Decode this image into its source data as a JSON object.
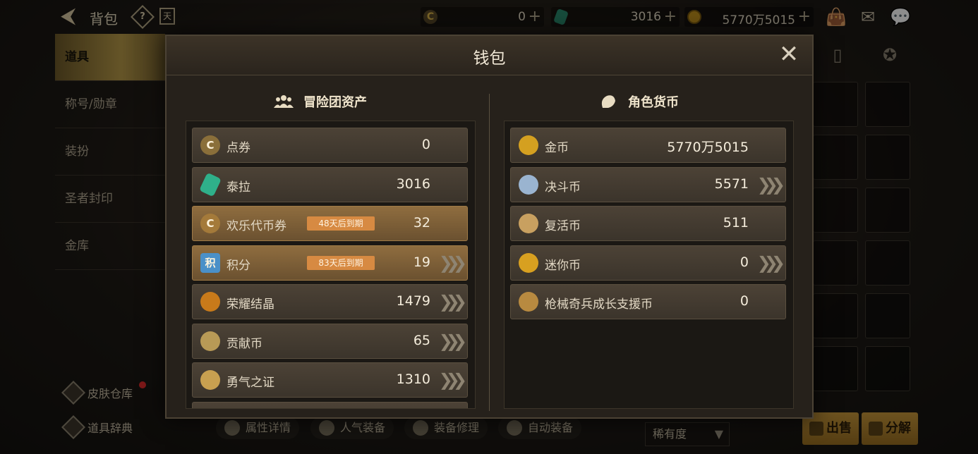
{
  "header": {
    "title": "背包",
    "help_label": "?",
    "calendar_label": "天",
    "currencies": [
      {
        "icon": "cera-point-icon",
        "value": "0",
        "plus": "+"
      },
      {
        "icon": "terra-gem-icon",
        "value": "3016",
        "plus": "+"
      },
      {
        "icon": "gold-coin-icon",
        "value": "5770万5015",
        "plus": "+"
      }
    ]
  },
  "sidebar": {
    "items": [
      {
        "label": "道具",
        "active": true
      },
      {
        "label": "称号/勋章",
        "active": false
      },
      {
        "label": "装扮",
        "active": false
      },
      {
        "label": "圣者封印",
        "active": false
      },
      {
        "label": "金库",
        "active": false
      }
    ],
    "skin_storage": "皮肤仓库",
    "item_dictionary": "道具辞典"
  },
  "toolbar": {
    "attr_details": "属性详情",
    "popular_equipment": "人气装备",
    "repair_equipment": "装备修理",
    "auto_equip": "自动装备",
    "sort_label": "稀有度",
    "sell_label": "出售",
    "dismantle_label": "分解"
  },
  "wallet": {
    "title": "钱包",
    "close_label": "✕",
    "adventure": {
      "heading": "冒险团资产",
      "rows": [
        {
          "name": "点券",
          "value": "0",
          "badge": "",
          "arrow": false,
          "highlight": false,
          "icon": "cera-point-icon",
          "color": "#8a6f3a"
        },
        {
          "name": "泰拉",
          "value": "3016",
          "badge": "",
          "arrow": false,
          "highlight": false,
          "icon": "terra-gem-icon",
          "color": "#2fb08a"
        },
        {
          "name": "欢乐代币券",
          "value": "32",
          "badge": "48天后到期",
          "arrow": false,
          "highlight": true,
          "icon": "joy-token-icon",
          "color": "#a47a3a"
        },
        {
          "name": "积分",
          "value": "19",
          "badge": "83天后到期",
          "arrow": true,
          "highlight": true,
          "icon": "points-icon",
          "color": "#4a90c8"
        },
        {
          "name": "荣耀结晶",
          "value": "1479",
          "badge": "",
          "arrow": true,
          "highlight": false,
          "icon": "glory-crystal-icon",
          "color": "#c87a1a"
        },
        {
          "name": "贡献币",
          "value": "65",
          "badge": "",
          "arrow": true,
          "highlight": false,
          "icon": "contribution-coin-icon",
          "color": "#b89a56"
        },
        {
          "name": "勇气之证",
          "value": "1310",
          "badge": "",
          "arrow": true,
          "highlight": false,
          "icon": "courage-proof-icon",
          "color": "#c8a050"
        }
      ]
    },
    "character": {
      "heading": "角色货币",
      "rows": [
        {
          "name": "金币",
          "value": "5770万5015",
          "arrow": false,
          "icon": "gold-coin-icon",
          "color": "#d4a020"
        },
        {
          "name": "决斗币",
          "value": "5571",
          "arrow": true,
          "icon": "duel-coin-icon",
          "color": "#9ab4d0"
        },
        {
          "name": "复活币",
          "value": "511",
          "arrow": false,
          "icon": "revive-coin-icon",
          "color": "#c8a060"
        },
        {
          "name": "迷你币",
          "value": "0",
          "arrow": true,
          "icon": "mini-coin-icon",
          "color": "#d8a020"
        },
        {
          "name": "枪械奇兵成长支援币",
          "value": "0",
          "arrow": false,
          "icon": "gunner-support-coin-icon",
          "color": "#b88a40"
        }
      ]
    }
  },
  "icon_glyphs": {
    "back": "⮜",
    "mail": "✉",
    "chat": "💬",
    "bag": "👜",
    "cera": "C",
    "points": "积",
    "arrow": "❯❯❯",
    "dropdown": "▼"
  }
}
